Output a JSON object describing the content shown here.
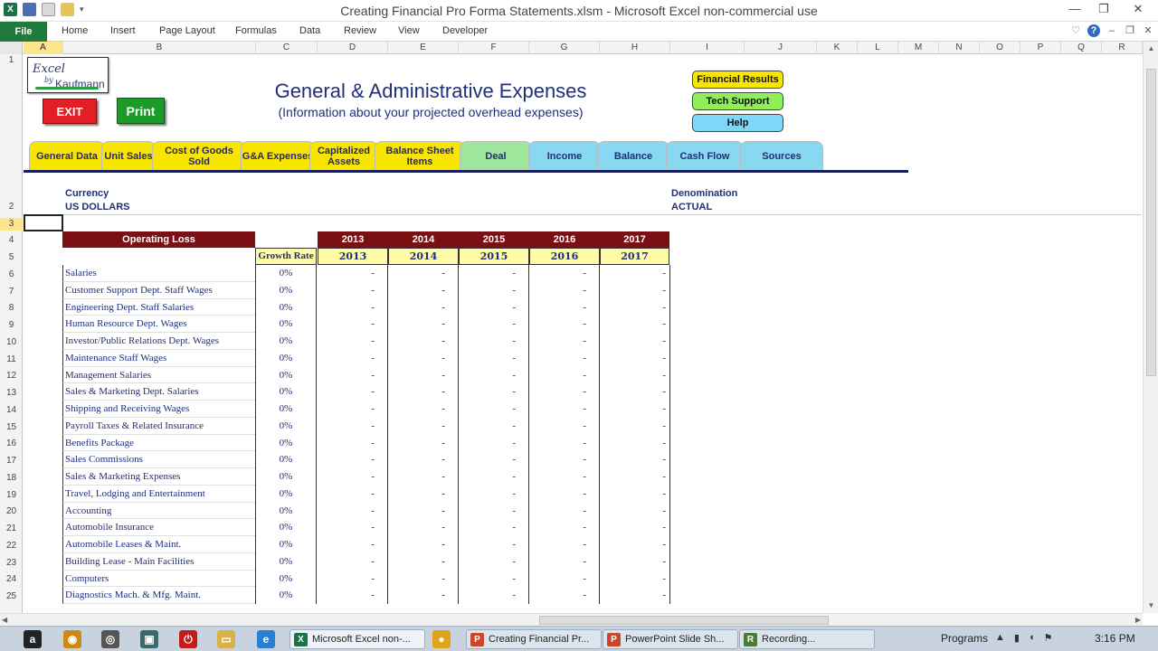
{
  "window": {
    "title": "Creating Financial Pro Forma Statements.xlsm  -  Microsoft Excel non-commercial use",
    "minimize": "—",
    "restore": "❐",
    "close": "✕"
  },
  "ribbon": {
    "file": "File",
    "tabs": [
      "Home",
      "Insert",
      "Page Layout",
      "Formulas",
      "Data",
      "Review",
      "View",
      "Developer"
    ]
  },
  "columns": [
    "A",
    "B",
    "C",
    "D",
    "E",
    "F",
    "G",
    "H",
    "I",
    "J",
    "K",
    "L",
    "M",
    "N",
    "O",
    "P",
    "Q",
    "R"
  ],
  "rows": [
    "1",
    "2",
    "3",
    "4",
    "5",
    "6",
    "7",
    "8",
    "9",
    "10",
    "11",
    "12",
    "13",
    "14",
    "15",
    "16",
    "17",
    "18",
    "19",
    "20",
    "21",
    "22",
    "23",
    "24",
    "25"
  ],
  "logo": {
    "line1": "Excel",
    "line2": "by",
    "line3": "Kaufmann"
  },
  "buttons": {
    "exit": "EXIT",
    "print": "Print",
    "financial_results": "Financial Results",
    "tech_support": "Tech Support",
    "help": "Help"
  },
  "header": {
    "title": "General & Administrative Expenses",
    "subtitle": "(Information  about your  projected overhead expenses)"
  },
  "nav_tabs": [
    {
      "label": "General Data",
      "color": "#f8e500"
    },
    {
      "label": "Unit Sales",
      "color": "#f8e500"
    },
    {
      "label": "Cost of Goods  Sold",
      "color": "#f8e500"
    },
    {
      "label": "G&A Expenses",
      "color": "#f8e500"
    },
    {
      "label": "Capitalized Assets",
      "color": "#f8e500"
    },
    {
      "label": "Balance Sheet Items",
      "color": "#f8e500"
    },
    {
      "label": "Deal",
      "color": "#9de69b"
    },
    {
      "label": "Income",
      "color": "#88d8f2"
    },
    {
      "label": "Balance",
      "color": "#88d8f2"
    },
    {
      "label": "Cash Flow",
      "color": "#88d8f2"
    },
    {
      "label": "Sources",
      "color": "#88d8f2"
    }
  ],
  "info": {
    "currency_label": "Currency",
    "currency_value": "US DOLLARS",
    "denomination_label": "Denomination",
    "denomination_value": "ACTUAL"
  },
  "table": {
    "section_title": "Operating Loss",
    "growth_rate_header": "Growth Rate",
    "years": [
      "2013",
      "2014",
      "2015",
      "2016",
      "2017"
    ],
    "rows": [
      {
        "name": "Salaries",
        "growth": "0%",
        "values": [
          "-",
          "-",
          "-",
          "-",
          "-"
        ]
      },
      {
        "name": "Customer Support Dept. Staff Wages",
        "growth": "0%",
        "values": [
          "-",
          "-",
          "-",
          "-",
          "-"
        ]
      },
      {
        "name": "Engineering Dept. Staff Salaries",
        "growth": "0%",
        "values": [
          "-",
          "-",
          "-",
          "-",
          "-"
        ]
      },
      {
        "name": "Human Resource Dept. Wages",
        "growth": "0%",
        "values": [
          "-",
          "-",
          "-",
          "-",
          "-"
        ]
      },
      {
        "name": "Investor/Public Relations Dept. Wages",
        "growth": "0%",
        "values": [
          "-",
          "-",
          "-",
          "-",
          "-"
        ]
      },
      {
        "name": "Maintenance Staff Wages",
        "growth": "0%",
        "values": [
          "-",
          "-",
          "-",
          "-",
          "-"
        ]
      },
      {
        "name": "Management Salaries",
        "growth": "0%",
        "values": [
          "-",
          "-",
          "-",
          "-",
          "-"
        ]
      },
      {
        "name": "Sales & Marketing Dept. Salaries",
        "growth": "0%",
        "values": [
          "-",
          "-",
          "-",
          "-",
          "-"
        ]
      },
      {
        "name": "Shipping and Receiving Wages",
        "growth": "0%",
        "values": [
          "-",
          "-",
          "-",
          "-",
          "-"
        ]
      },
      {
        "name": "Payroll Taxes & Related Insurance",
        "growth": "0%",
        "values": [
          "-",
          "-",
          "-",
          "-",
          "-"
        ]
      },
      {
        "name": "Benefits Package",
        "growth": "0%",
        "values": [
          "-",
          "-",
          "-",
          "-",
          "-"
        ]
      },
      {
        "name": "Sales Commissions",
        "growth": "0%",
        "values": [
          "-",
          "-",
          "-",
          "-",
          "-"
        ]
      },
      {
        "name": "Sales & Marketing Expenses",
        "growth": "0%",
        "values": [
          "-",
          "-",
          "-",
          "-",
          "-"
        ]
      },
      {
        "name": "Travel, Lodging and Entertainment",
        "growth": "0%",
        "values": [
          "-",
          "-",
          "-",
          "-",
          "-"
        ]
      },
      {
        "name": "Accounting",
        "growth": "0%",
        "values": [
          "-",
          "-",
          "-",
          "-",
          "-"
        ]
      },
      {
        "name": "Automobile Insurance",
        "growth": "0%",
        "values": [
          "-",
          "-",
          "-",
          "-",
          "-"
        ]
      },
      {
        "name": "Automobile Leases & Maint.",
        "growth": "0%",
        "values": [
          "-",
          "-",
          "-",
          "-",
          "-"
        ]
      },
      {
        "name": "Building Lease - Main Facilities",
        "growth": "0%",
        "values": [
          "-",
          "-",
          "-",
          "-",
          "-"
        ]
      },
      {
        "name": "Computers",
        "growth": "0%",
        "values": [
          "-",
          "-",
          "-",
          "-",
          "-"
        ]
      },
      {
        "name": "Diagnostics Mach. & Mfg. Maint.",
        "growth": "0%",
        "values": [
          "-",
          "-",
          "-",
          "-",
          "-"
        ]
      }
    ]
  },
  "taskbar": {
    "items": [
      {
        "label": "Microsoft Excel non-...",
        "icon": "X",
        "color": "#1e7145"
      },
      {
        "label": "Creating Financial Pr...",
        "icon": "P",
        "color": "#c8472a"
      },
      {
        "label": "PowerPoint Slide Sh...",
        "icon": "P",
        "color": "#c8472a"
      },
      {
        "label": "Recording...",
        "icon": "R",
        "color": "#4a7a3a"
      }
    ],
    "programs": "Programs",
    "clock": "3:16 PM"
  }
}
